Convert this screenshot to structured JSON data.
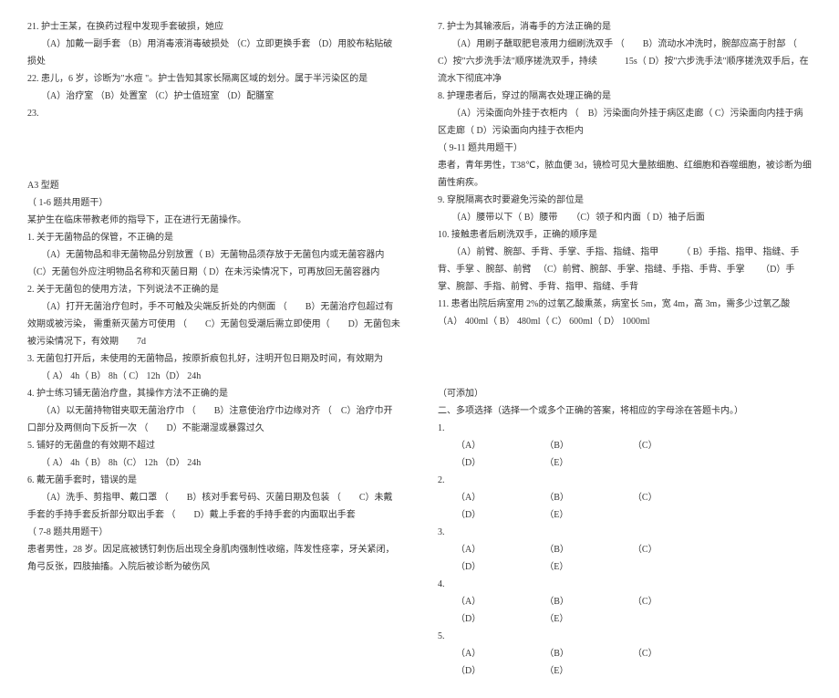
{
  "left": {
    "q21_l1": "21. 护士王某，在换药过程中发现手套破损，她应",
    "q21_l2": "（A）加戴一副手套 （B）用消毒液消毒破损处 （C）立即更换手套 （D）用胶布粘贴破损处",
    "q22_l1": "22. 患儿，6 岁，诊断为\"水痘 \"。护士告知其家长隔离区域的划分。属于半污染区的是",
    "q22_l2": "（A）治疗室 （B）处置室 （C）护士值班室 （D）配膳室",
    "q23_l1": "23.",
    "a3_title": "A3 型题",
    "a3_shared": "（ 1-6 题共用题干）",
    "a3_stem": "某护生在临床带教老师的指导下，正在进行无菌操作。",
    "a3_q1_l1": "1. 关于无菌物品的保管，不正确的是",
    "a3_q1_l2": "（A）无菌物品和非无菌物品分别放置（ B）无菌物品须存放于无菌包内或无菌容器内 （C）无菌包外应注明物品名称和灭菌日期（ D）在未污染情况下，可再放回无菌容器内",
    "a3_q2_l1": "2. 关于无菌包的使用方法，下列说法不正确的是",
    "a3_q2_l2": "（A）打开无菌治疗包时，手不可触及尖端反折处的内侧面 （　　B）无菌治疗包超过有效期或被污染， 需重新灭菌方可使用 （　　C）无菌包受潮后需立即使用（　　D）无菌包未被污染情况下，有效期　　7d",
    "a3_q3_l1": "3. 无菌包打开后，未使用的无菌物品，按原折痕包扎好，注明开包日期及时间，有效期为",
    "a3_q3_l2": "（ A） 4h（ B） 8h（ C） 12h（D） 24h",
    "a3_q4_l1": "4. 护士练习铺无菌治疗盘，其操作方法不正确的是",
    "a3_q4_l2": "（A）以无菌持物钳夹取无菌治疗巾 （　　B）注意使治疗巾边缘对齐 （　C）治疗巾开口部分及两侧向下反折一次 （　　D）不能潮湿或暴露过久",
    "a3_q5_l1": "5. 铺好的无菌盘的有效期不超过",
    "a3_q5_l2": "（ A） 4h（ B） 8h（C） 12h （D） 24h",
    "a3_q6_l1": "6. 戴无菌手套时，错误的是",
    "a3_q6_l2": "（A）洗手、剪指甲、戴口罩 （　　B）核对手套号码、灭菌日期及包装 （　　C）未戴手套的手持手套反折部分取出手套 （　　D）戴上手套的手持手套的内面取出手套",
    "a3_shared2": "（ 7-8 题共用题干）",
    "a3_stem2_l1": "患者男性，28 岁。因足底被锈钉刺伤后出现全身肌肉强制性收缩，阵发性痉挛，牙关紧闭，角弓反张，四肢抽搐。入院后被诊断为破伤风"
  },
  "right": {
    "q7_l1": "7. 护士为其输液后，消毒手的方法正确的是",
    "q7_l2": "（A）用刷子蘸取肥皂液用力细刷洗双手 （　　B）流动水冲洗时，腕部应高于肘部 （　C）按\"六步洗手法\"顺序搓洗双手，持续　　　15s（ D）按\"六步洗手法\"顺序搓洗双手后，在流水下彻底冲净",
    "q8_l1": "8. 护理患者后，穿过的隔离衣处理正确的是",
    "q8_l2": "（A）污染面向外挂于衣柜内 （　B）污染面向外挂于病区走廊（ C）污染面向内挂于病区走廊（ D）污染面向内挂于衣柜内",
    "shared3": "（ 9-11 题共用题干）",
    "stem3": "患者，青年男性，T38℃，脓血便 3d，镜检可见大量脓细胞、红细胞和吞噬细胞，被诊断为细菌性痢疾。",
    "q9_l1": "9. 穿脱隔离衣时要避免污染的部位是",
    "q9_l2": "（A）腰带以下（ B）腰带　　（C）领子和内面（ D）袖子后面",
    "q10_l1": "10. 接触患者后刷洗双手，正确的顺序是",
    "q10_l2": "（A）前臂、腕部、手背、手掌、手指、指缝、指甲　　　（ B）手指、指甲、指缝、手背、手掌 、腕部、前臂 　（C）前臂、腕部、手掌、指缝、手指、手背、手掌 　　（D）手掌、腕部、手指、前臂、手背、指甲、指缝、手背",
    "q11_l1": "11. 患者出院后病室用 2%的过氧乙酸熏蒸，病室长 5m，宽 4m，高 3m，需多少过氧乙酸（A） 400ml（ B） 480ml（ C） 600ml（ D） 1000ml",
    "add_note": "（可添加）",
    "multi_title": "二、多项选择（选择一个或多个正确的答案，将相应的字母涂在答题卡内。）",
    "m1": "1.",
    "m2": "2.",
    "m3": "3.",
    "m4": "4.",
    "m5": "5.",
    "optA": "（A）",
    "optB": "（B）",
    "optC": "（C）",
    "optD": "（D）",
    "optE": "（E）"
  }
}
